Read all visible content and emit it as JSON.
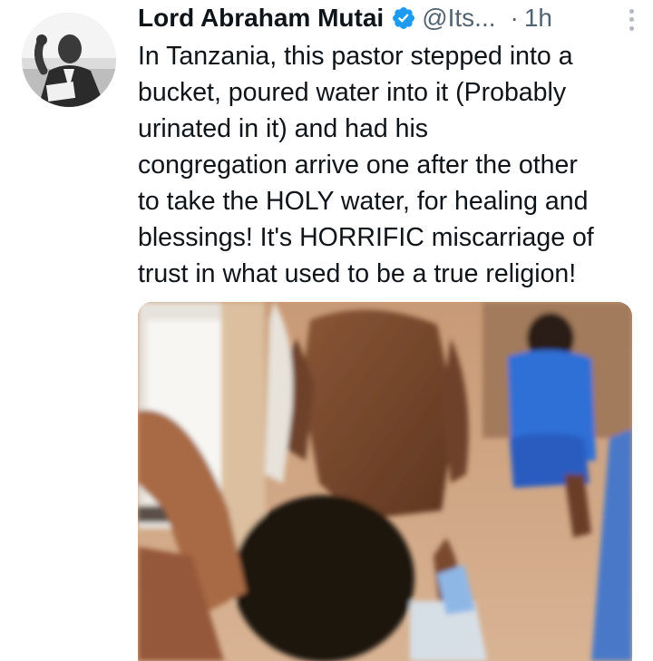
{
  "tweet": {
    "author": {
      "display_name": "Lord Abraham Mutai",
      "handle": "@Its...",
      "verified": true
    },
    "separator": "·",
    "time": "1h",
    "text_lines": [
      "In Tanzania, this pastor stepped into a",
      "bucket, poured water into it (Probably",
      "urinated in it) and had his",
      "congregation arrive one after the other",
      "to take the HOLY water, for healing and",
      "blessings! It's HORRIFIC miscarriage of",
      "trust in what used to be a true religion!"
    ],
    "icons": {
      "verified": "verified-badge-icon",
      "more": "more-options-icon"
    },
    "colors": {
      "verified_badge": "#1d9bf0",
      "secondary_text": "#536471",
      "primary_text": "#0f1419"
    }
  }
}
